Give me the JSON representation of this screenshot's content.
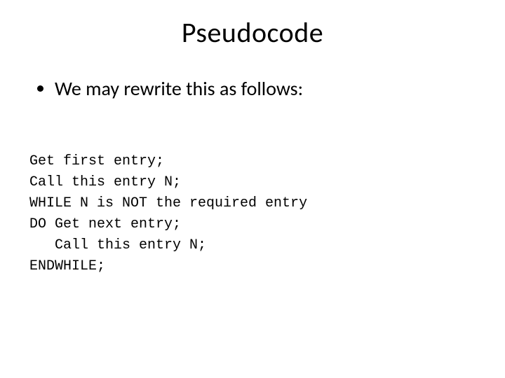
{
  "title": "Pseudocode",
  "bullet": "We may rewrite this as follows:",
  "code": {
    "l1": "Get first entry;",
    "l2": "Call this entry N;",
    "l3": "WHILE N is NOT the required entry",
    "l4": "DO Get next entry;",
    "l5": "   Call this entry N;",
    "l6": "ENDWHILE;"
  }
}
